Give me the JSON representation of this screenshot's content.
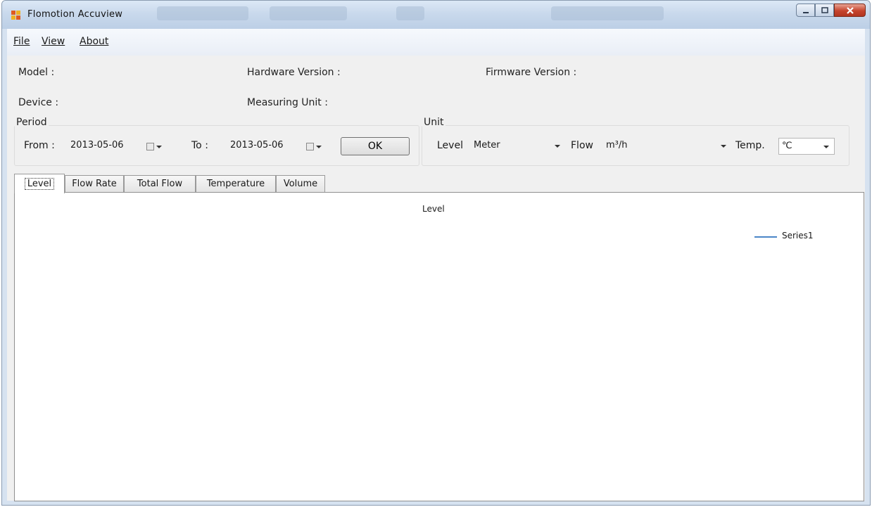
{
  "window": {
    "title": "Flomotion Accuview",
    "accent_color": "#4a86c8"
  },
  "menu": {
    "items": [
      "File",
      "View",
      "About"
    ]
  },
  "device_info": {
    "model_label": "Model :",
    "hardware_label": "Hardware Version :",
    "firmware_label": "Firmware Version :",
    "device_label": "Device :",
    "measuring_unit_label": "Measuring Unit :"
  },
  "period": {
    "title": "Period",
    "from_label": "From :",
    "from_value": "2013-05-06",
    "to_label": "To :",
    "to_value": "2013-05-06",
    "ok_label": "OK"
  },
  "unit": {
    "title": "Unit",
    "level_label": "Level",
    "level_value": "Meter",
    "flow_label": "Flow",
    "flow_value": "m³/h",
    "temp_label": "Temp.",
    "temp_value": "℃"
  },
  "tabs": [
    {
      "label": "Level",
      "active": true
    },
    {
      "label": "Flow Rate",
      "active": false
    },
    {
      "label": "Total Flow",
      "active": false
    },
    {
      "label": "Temperature",
      "active": false
    },
    {
      "label": "Volume",
      "active": false
    }
  ],
  "chart": {
    "title": "Level",
    "legend": "Series1"
  }
}
